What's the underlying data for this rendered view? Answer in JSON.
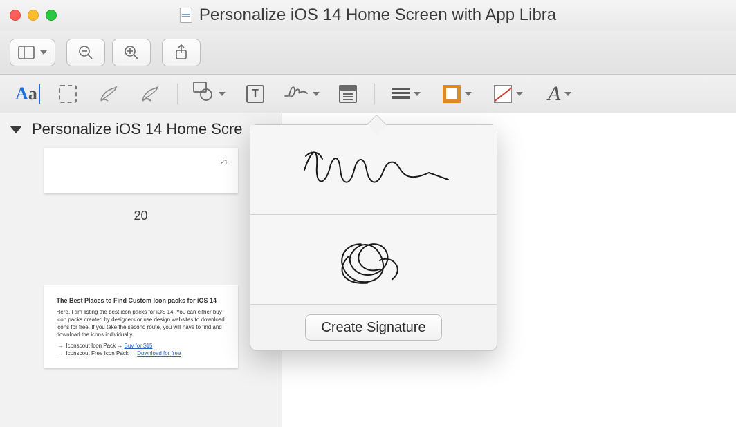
{
  "window": {
    "title": "Personalize iOS 14 Home Screen with App Libra"
  },
  "markup_toolbar": {
    "text_style_label": "Aa",
    "textbox_glyph": "T",
    "font_glyph": "A"
  },
  "sidebar": {
    "doc_title": "Personalize iOS 14 Home Scre",
    "thumb_top_page_indicator": "21",
    "current_page_label": "20",
    "thumb2": {
      "heading": "The Best Places to Find Custom Icon packs for iOS 14",
      "body": "Here, I am listing the best icon packs for iOS 14. You can either buy icon packs created by designers or use design websites to download icons for free. If you take the second route, you will have to find and download the icons individually.",
      "li1_prefix": "Iconscout Icon Pack → ",
      "li1_link": "Buy for $15",
      "li2_prefix": "Iconscout Free Icon Pack → ",
      "li2_link": "Download for free"
    }
  },
  "popover": {
    "create_label": "Create Signature"
  }
}
